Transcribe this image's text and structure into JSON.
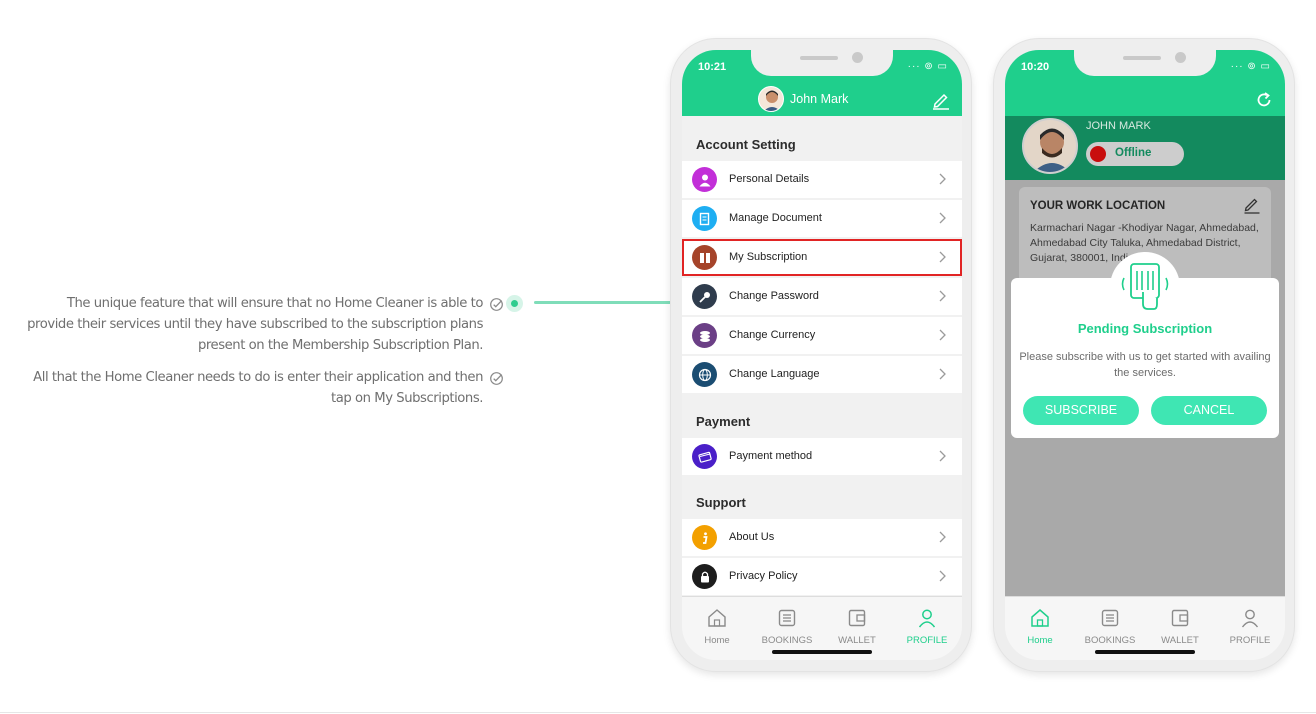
{
  "features": [
    "The unique feature that will ensure that no Home Cleaner is able to provide their services until they have subscribed to the subscription plans present on the Membership Subscription Plan.",
    "All that the Home Cleaner needs to do is enter their application and then tap on My Subscriptions."
  ],
  "colors": {
    "accent": "#1fcf8c",
    "dark_green": "#138a5e",
    "button": "#3fe6b3",
    "highlight": "#e12424",
    "offline": "#c80d0d"
  },
  "phone_a": {
    "time": "10:21",
    "user_name": "John Mark",
    "sections": {
      "account": "Account Setting",
      "payment": "Payment",
      "support": "Support"
    },
    "items": {
      "personal": {
        "label": "Personal Details",
        "icon": "person-icon"
      },
      "document": {
        "label": "Manage Document",
        "icon": "document-icon"
      },
      "subscription": {
        "label": "My Subscription",
        "icon": "subscription-icon"
      },
      "password": {
        "label": "Change Password",
        "icon": "key-icon"
      },
      "currency": {
        "label": "Change Currency",
        "icon": "coins-icon"
      },
      "language": {
        "label": "Change Language",
        "icon": "globe-icon"
      },
      "payment_method": {
        "label": "Payment method",
        "icon": "card-icon"
      },
      "about": {
        "label": "About Us",
        "icon": "info-icon"
      },
      "privacy": {
        "label": "Privacy Policy",
        "icon": "lock-icon"
      }
    },
    "tabs": {
      "home": "Home",
      "bookings": "BOOKINGS",
      "wallet": "WALLET",
      "profile": "PROFILE"
    },
    "active_tab": "profile"
  },
  "phone_b": {
    "time": "10:20",
    "user_name": "JOHN MARK",
    "status": "Offline",
    "location_title": "YOUR WORK LOCATION",
    "address": "Karmachari Nagar -Khodiyar Nagar, Ahmedabad, Ahmedabad City Taluka, Ahmedabad District, Gujarat, 380001, India",
    "dialog": {
      "title": "Pending Subscription",
      "message": "Please subscribe with us to get started with availing the services.",
      "subscribe": "SUBSCRIBE",
      "cancel": "CANCEL"
    },
    "tabs": {
      "home": "Home",
      "bookings": "BOOKINGS",
      "wallet": "WALLET",
      "profile": "PROFILE"
    },
    "active_tab": "home"
  }
}
